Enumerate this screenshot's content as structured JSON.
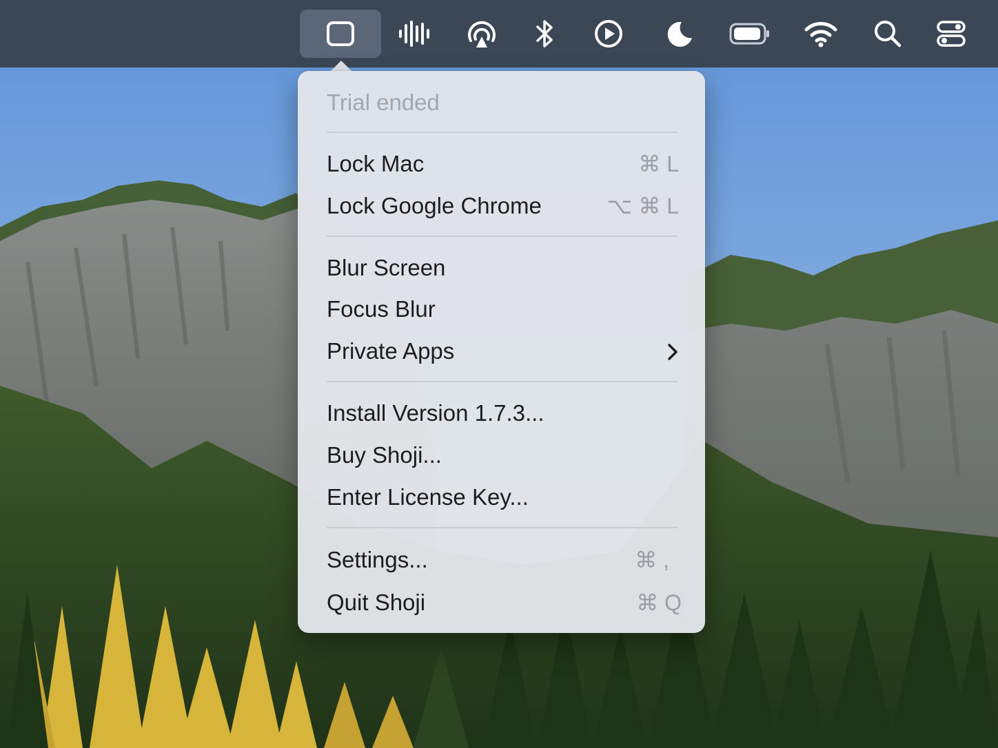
{
  "menubar": {
    "icons": [
      {
        "name": "shoji-app-icon",
        "active": true
      },
      {
        "name": "audio-waveform-icon"
      },
      {
        "name": "airplay-audio-icon"
      },
      {
        "name": "bluetooth-icon"
      },
      {
        "name": "play-circle-icon"
      },
      {
        "name": "moon-icon"
      },
      {
        "name": "battery-icon"
      },
      {
        "name": "wifi-icon"
      },
      {
        "name": "search-icon"
      },
      {
        "name": "control-center-icon"
      }
    ]
  },
  "menu": {
    "status": "Trial ended",
    "lock_mac": {
      "label": "Lock Mac",
      "shortcut": "⌘ L"
    },
    "lock_chrome": {
      "label": "Lock Google Chrome",
      "shortcut": "⌥ ⌘ L"
    },
    "blur_screen": {
      "label": "Blur Screen"
    },
    "focus_blur": {
      "label": "Focus Blur"
    },
    "private_apps": {
      "label": "Private Apps"
    },
    "install_version": {
      "label": "Install Version 1.7.3..."
    },
    "buy": {
      "label": "Buy Shoji..."
    },
    "license": {
      "label": "Enter License Key..."
    },
    "settings": {
      "label": "Settings...",
      "shortcut": "⌘ ,"
    },
    "quit": {
      "label": "Quit Shoji",
      "shortcut": "⌘ Q"
    }
  },
  "colors": {
    "menubar": "#3c4756",
    "menu_bg": "#e2e5e9",
    "sky": "#7aa9dd",
    "accent_foliage": "#d9b73a"
  }
}
